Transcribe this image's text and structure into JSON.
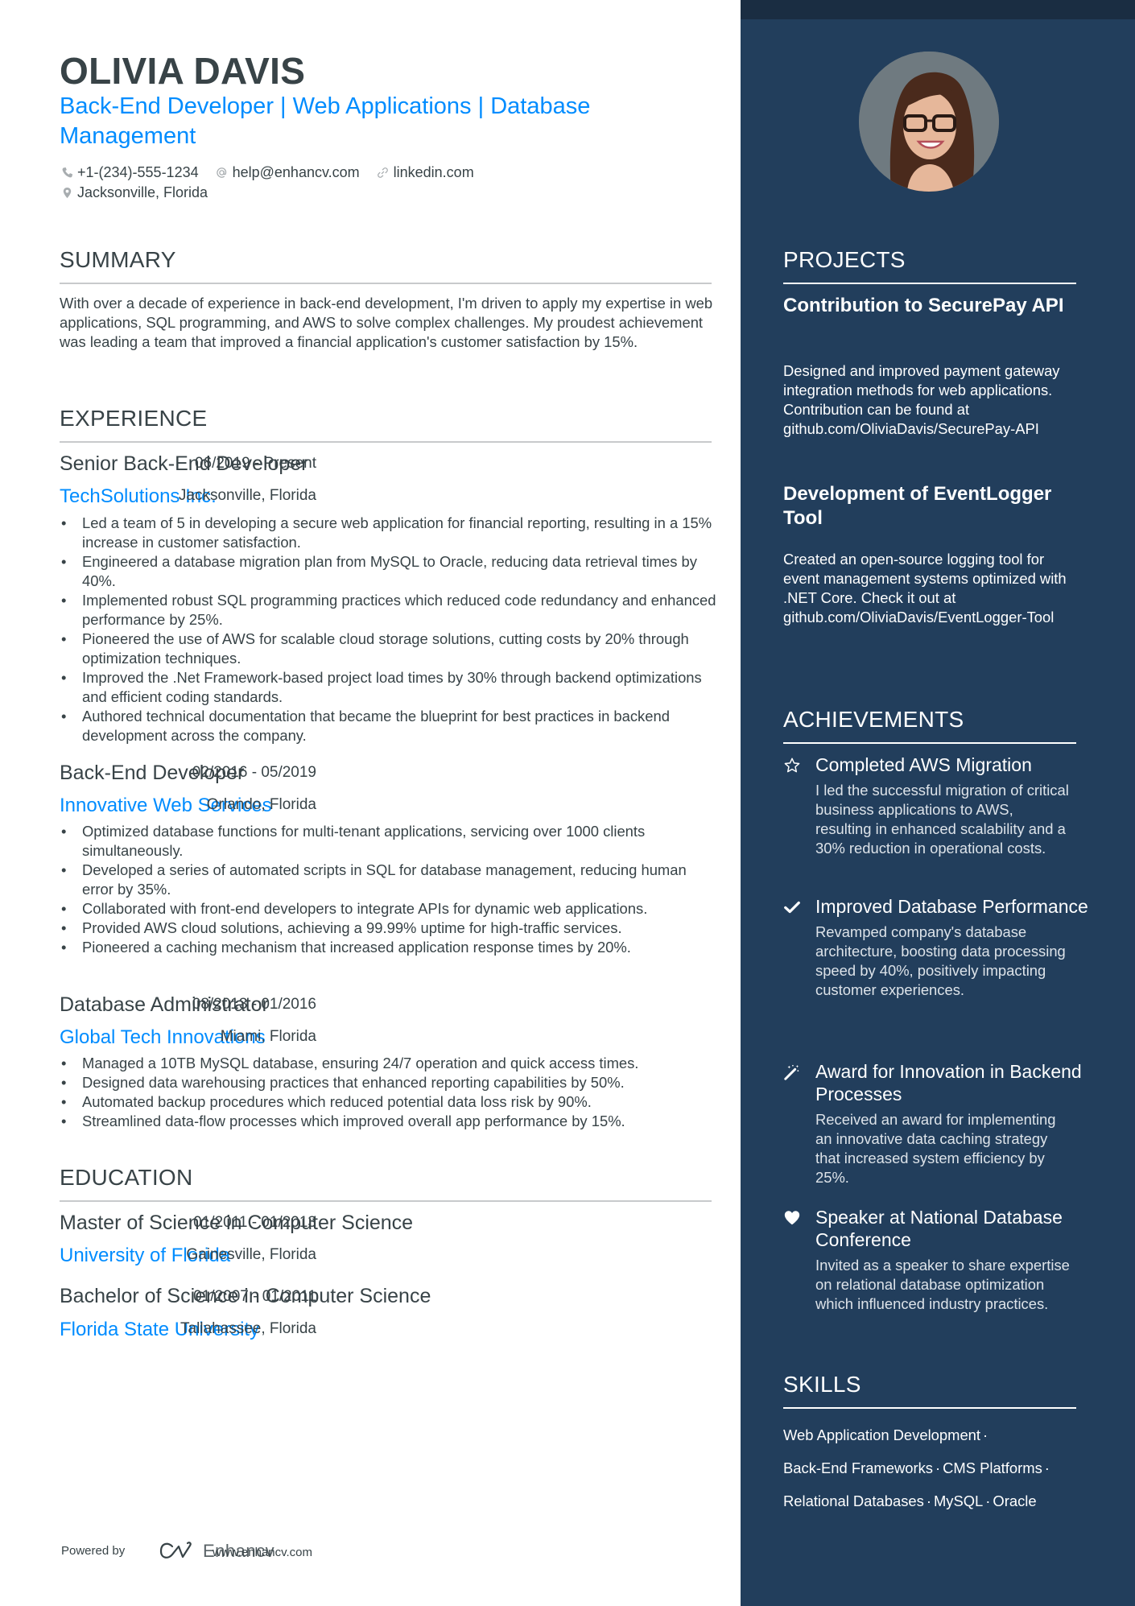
{
  "header": {
    "name": "OLIVIA DAVIS",
    "headline": "Back-End Developer | Web Applications | Database Management",
    "contact": {
      "phone": "+1-(234)-555-1234",
      "email": "help@enhancv.com",
      "link": "linkedin.com",
      "location": "Jacksonville, Florida"
    }
  },
  "summary": {
    "title": "SUMMARY",
    "text": "With over a decade of experience in back-end development, I'm driven to apply my expertise in web applications, SQL programming, and AWS to solve complex challenges. My proudest achievement was leading a team that improved a financial application's customer satisfaction by 15%."
  },
  "experience": {
    "title": "EXPERIENCE",
    "items": [
      {
        "role": "Senior Back-End Developer",
        "dates": "06/2019 - Present",
        "company": "TechSolutions Inc.",
        "location": "Jacksonville, Florida",
        "bullets": [
          "Led a team of 5 in developing a secure web application for financial reporting, resulting in a 15% increase in customer satisfaction.",
          "Engineered a database migration plan from MySQL to Oracle, reducing data retrieval times by 40%.",
          "Implemented robust SQL programming practices which reduced code redundancy and enhanced performance by 25%.",
          "Pioneered the use of AWS for scalable cloud storage solutions, cutting costs by 20% through optimization techniques.",
          "Improved the .Net Framework-based project load times by 30% through backend optimizations and efficient coding standards.",
          "Authored technical documentation that became the blueprint for best practices in backend development across the company."
        ]
      },
      {
        "role": "Back-End Developer",
        "dates": "02/2016 - 05/2019",
        "company": "Innovative Web Services",
        "location": "Orlando, Florida",
        "bullets": [
          "Optimized database functions for multi-tenant applications, servicing over 1000 clients simultaneously.",
          "Developed a series of automated scripts in SQL for database management, reducing human error by 35%.",
          "Collaborated with front-end developers to integrate APIs for dynamic web applications.",
          "Provided AWS cloud solutions, achieving a 99.99% uptime for high-traffic services.",
          "Pioneered a caching mechanism that increased application response times by 20%."
        ]
      },
      {
        "role": "Database Administrator",
        "dates": "08/2013 - 01/2016",
        "company": "Global Tech Innovations",
        "location": "Miami, Florida",
        "bullets": [
          "Managed a 10TB MySQL database, ensuring 24/7 operation and quick access times.",
          "Designed data warehousing practices that enhanced reporting capabilities by 50%.",
          "Automated backup procedures which reduced potential data loss risk by 90%.",
          "Streamlined data-flow processes which improved overall app performance by 15%."
        ]
      }
    ]
  },
  "education": {
    "title": "EDUCATION",
    "items": [
      {
        "degree": "Master of Science in Computer Science",
        "dates": "01/2011 - 01/2013",
        "school": "University of Florida",
        "location": "Gainesville, Florida"
      },
      {
        "degree": "Bachelor of Science in Computer Science",
        "dates": "01/2007 - 01/2011",
        "school": "Florida State University",
        "location": "Tallahassee, Florida"
      }
    ]
  },
  "projects": {
    "title": "PROJECTS",
    "items": [
      {
        "title": "Contribution to SecurePay API",
        "description": "Designed and improved payment gateway integration methods for web applications. Contribution can be found at github.com/OliviaDavis/SecurePay-API"
      },
      {
        "title": "Development of EventLogger Tool",
        "description": "Created an open-source logging tool for event management systems optimized with .NET Core. Check it out at github.com/OliviaDavis/EventLogger-Tool"
      }
    ]
  },
  "achievements": {
    "title": "ACHIEVEMENTS",
    "items": [
      {
        "icon": "star-icon",
        "title": "Completed AWS Migration",
        "description": "I led the successful migration of critical business applications to AWS, resulting in enhanced scalability and a 30% reduction in operational costs."
      },
      {
        "icon": "check-icon",
        "title": "Improved Database Performance",
        "description": "Revamped company's database architecture, boosting data processing speed by 40%, positively impacting customer experiences."
      },
      {
        "icon": "magic-wand-icon",
        "title": "Award for Innovation in Backend Processes",
        "description": "Received an award for implementing an innovative data caching strategy that increased system efficiency by 25%."
      },
      {
        "icon": "heart-icon",
        "title": "Speaker at National Database Conference",
        "description": "Invited as a speaker to share expertise on relational database optimization which influenced industry practices."
      }
    ]
  },
  "skills": {
    "title": "SKILLS",
    "items": [
      "Web Application Development",
      "Back-End Frameworks",
      "CMS Platforms",
      "Relational Databases",
      "MySQL",
      "Oracle"
    ]
  },
  "footer": {
    "powered_by": "Powered by",
    "brand": "Enhancv",
    "url": "www.enhancv.com"
  },
  "colors": {
    "accent": "#008cff",
    "sidebar": "#223e5c",
    "text": "#384347"
  }
}
